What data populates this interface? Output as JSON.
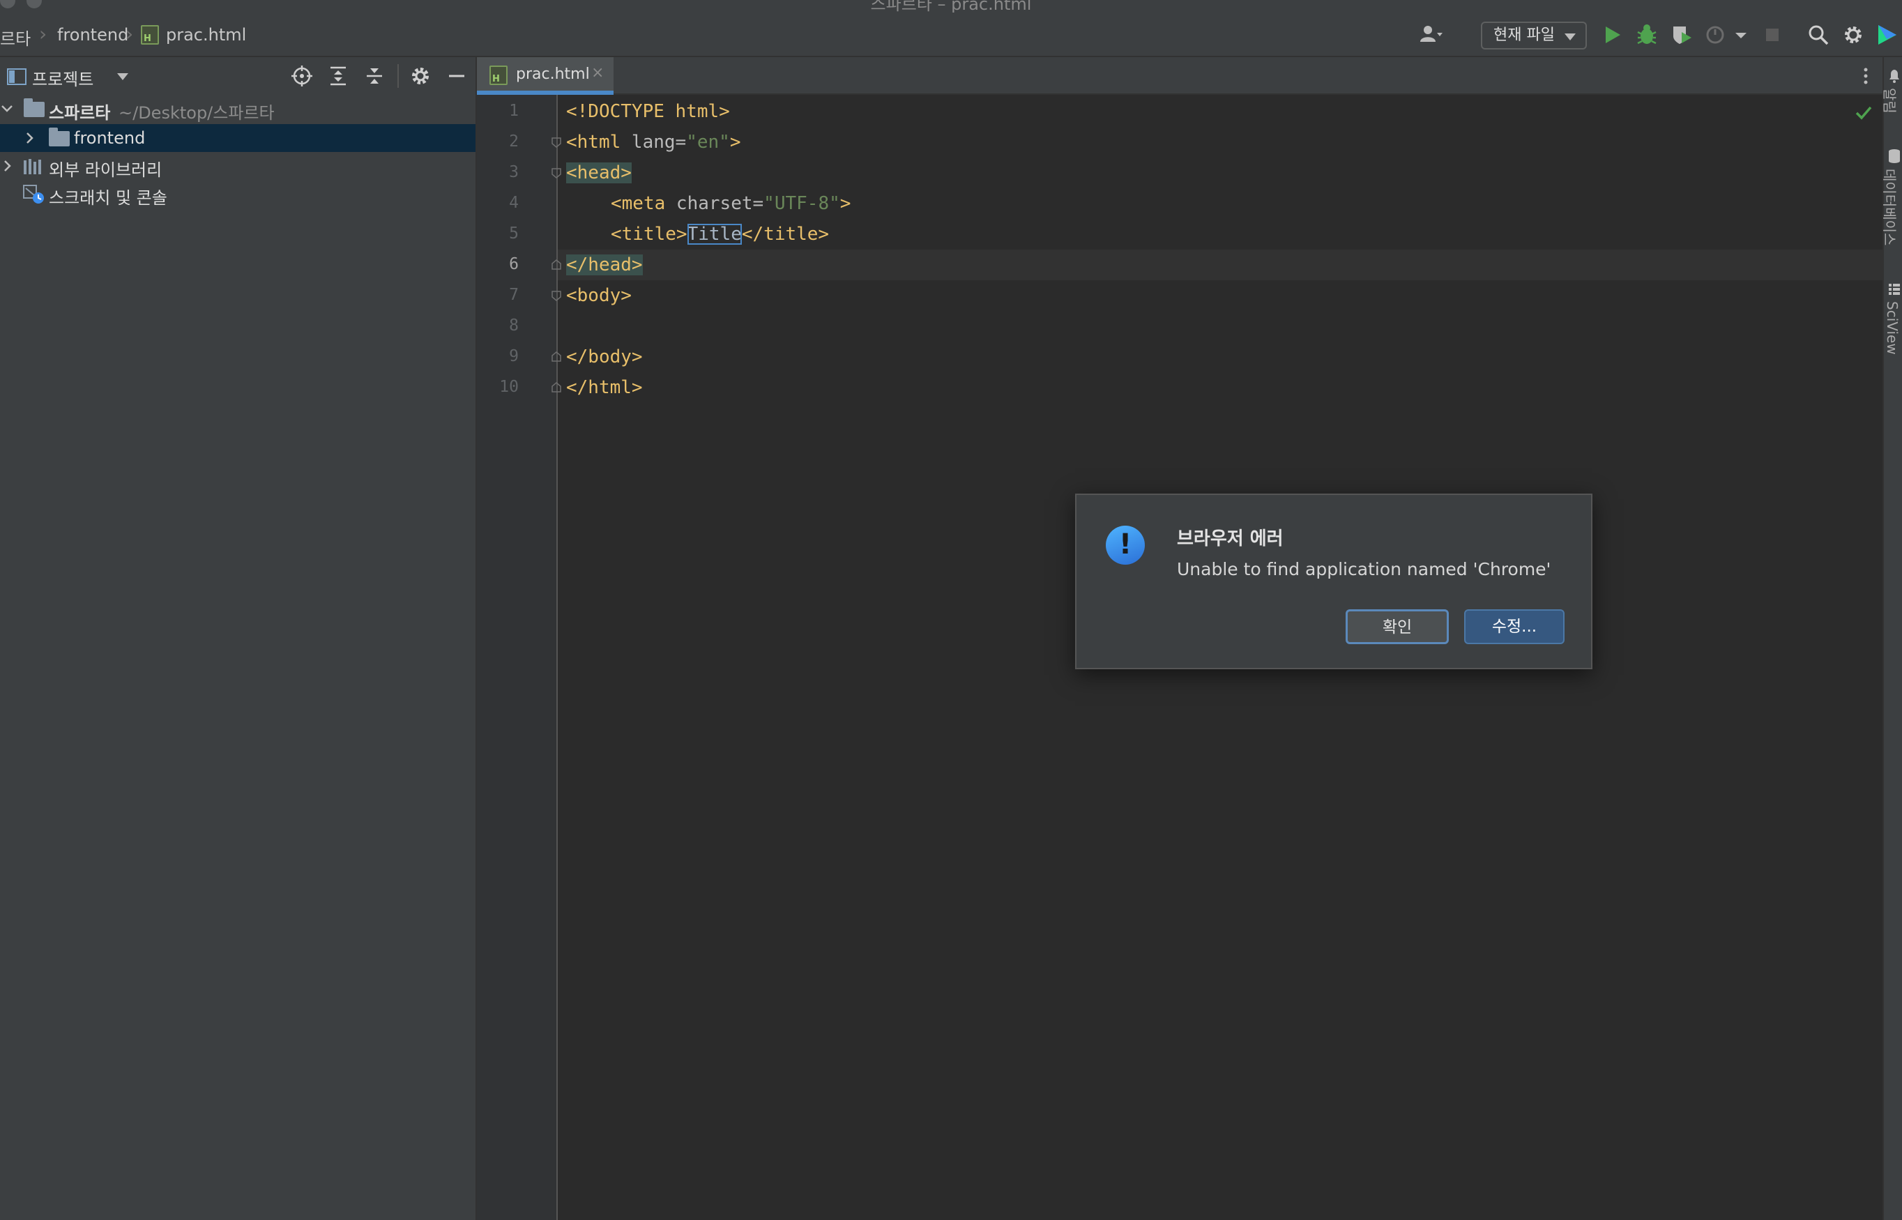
{
  "window": {
    "title": "스파르타 – prac.html"
  },
  "navbar": {
    "breadcrumbs": [
      "르타",
      "frontend",
      "prac.html"
    ],
    "run_config": "현재 파일",
    "icons": [
      "user-icon",
      "run-icon",
      "debug-icon",
      "coverage-icon",
      "profile-icon",
      "stop-icon",
      "search-icon",
      "gear-icon",
      "jetbrains-logo-icon"
    ]
  },
  "project_panel": {
    "title": "프로젝트",
    "tree": [
      {
        "label": "스파르타",
        "sub": "~/Desktop/스파르타",
        "expanded": true
      },
      {
        "label": "frontend",
        "selected": true
      },
      {
        "label": "외부 라이브러리"
      },
      {
        "label": "스크래치 및 콘솔"
      }
    ]
  },
  "editor": {
    "tab": "prac.html",
    "current_line": 6,
    "line_numbers": [
      "1",
      "2",
      "3",
      "4",
      "5",
      "6",
      "7",
      "8",
      "9",
      "10"
    ],
    "code": {
      "l1": "<!DOCTYPE html>",
      "l2_open": "<html",
      "l2_attr": " lang=",
      "l2_val": "\"en\"",
      "l2_close": ">",
      "l3": "<head>",
      "l4_open": "<meta",
      "l4_attr": " charset=",
      "l4_val": "\"UTF-8\"",
      "l4_close": ">",
      "l5_open": "<title>",
      "l5_text": "Title",
      "l5_close": "</title>",
      "l6": "</head>",
      "l7": "<body>",
      "l9": "</body>",
      "l10": "</html>"
    }
  },
  "right_strip": {
    "labels": [
      "알림",
      "데이터베이스",
      "SciView"
    ]
  },
  "dialog": {
    "title": "브라우저 에러",
    "message": "Unable to find application named 'Chrome'",
    "ok_label": "확인",
    "edit_label": "수정..."
  },
  "colors": {
    "accent": "#4a88c7",
    "tag": "#e8bf6a",
    "string": "#6a8759",
    "run_green": "#4fa34f"
  }
}
